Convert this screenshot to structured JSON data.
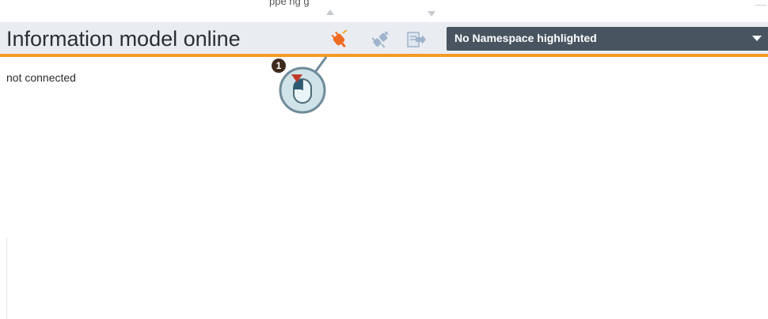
{
  "top_caption": "ppe ng   g",
  "header": {
    "title": "Information model online",
    "accent_color": "#f59a23"
  },
  "toolbar": {
    "buttons": [
      {
        "name": "connect",
        "icon": "plug-connect-icon"
      },
      {
        "name": "disconnect",
        "icon": "plug-disconnect-icon"
      },
      {
        "name": "export",
        "icon": "export-icon"
      }
    ]
  },
  "namespace_select": {
    "value": "No Namespace highlighted"
  },
  "content": {
    "status": "not connected"
  },
  "callout": {
    "step": "1",
    "icon": "mouse-click-icon"
  }
}
